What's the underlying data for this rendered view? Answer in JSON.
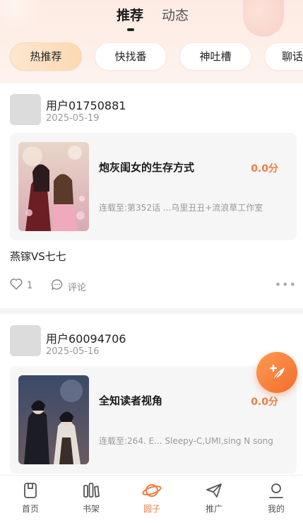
{
  "header": {
    "tabs": [
      {
        "label": "推荐",
        "active": true
      },
      {
        "label": "动态",
        "active": false
      }
    ]
  },
  "categories": [
    {
      "label": "热推荐",
      "active": true
    },
    {
      "label": "快找番",
      "active": false
    },
    {
      "label": "神吐槽",
      "active": false
    },
    {
      "label": "聊话",
      "active": false
    }
  ],
  "posts": [
    {
      "username": "用户01750881",
      "date": "2025-05-19",
      "comic": {
        "title": "炮灰闺女的生存方式",
        "score": "0.0分",
        "meta": "连载至:第352话 ...乌里丑丑+流浪草工作室"
      },
      "text": "燕镓VS七七",
      "likes": "1",
      "comment_label": "评论"
    },
    {
      "username": "用户60094706",
      "date": "2025-05-16",
      "comic": {
        "title": "全知读者视角",
        "score": "0.0分",
        "meta": "连载至:264. E...  Sleepy-C,UMI,sing N song"
      }
    }
  ],
  "bottom_nav": [
    {
      "label": "首页",
      "icon": "home-icon",
      "active": false
    },
    {
      "label": "书架",
      "icon": "bookshelf-icon",
      "active": false
    },
    {
      "label": "圆子",
      "icon": "planet-icon",
      "active": true
    },
    {
      "label": "推广",
      "icon": "paper-plane-icon",
      "active": false
    },
    {
      "label": "我的",
      "icon": "user-icon",
      "active": false
    }
  ],
  "colors": {
    "accent": "#f07c3e",
    "pill_active": "#fbd9b2",
    "card_bg": "#f6f6f6"
  }
}
